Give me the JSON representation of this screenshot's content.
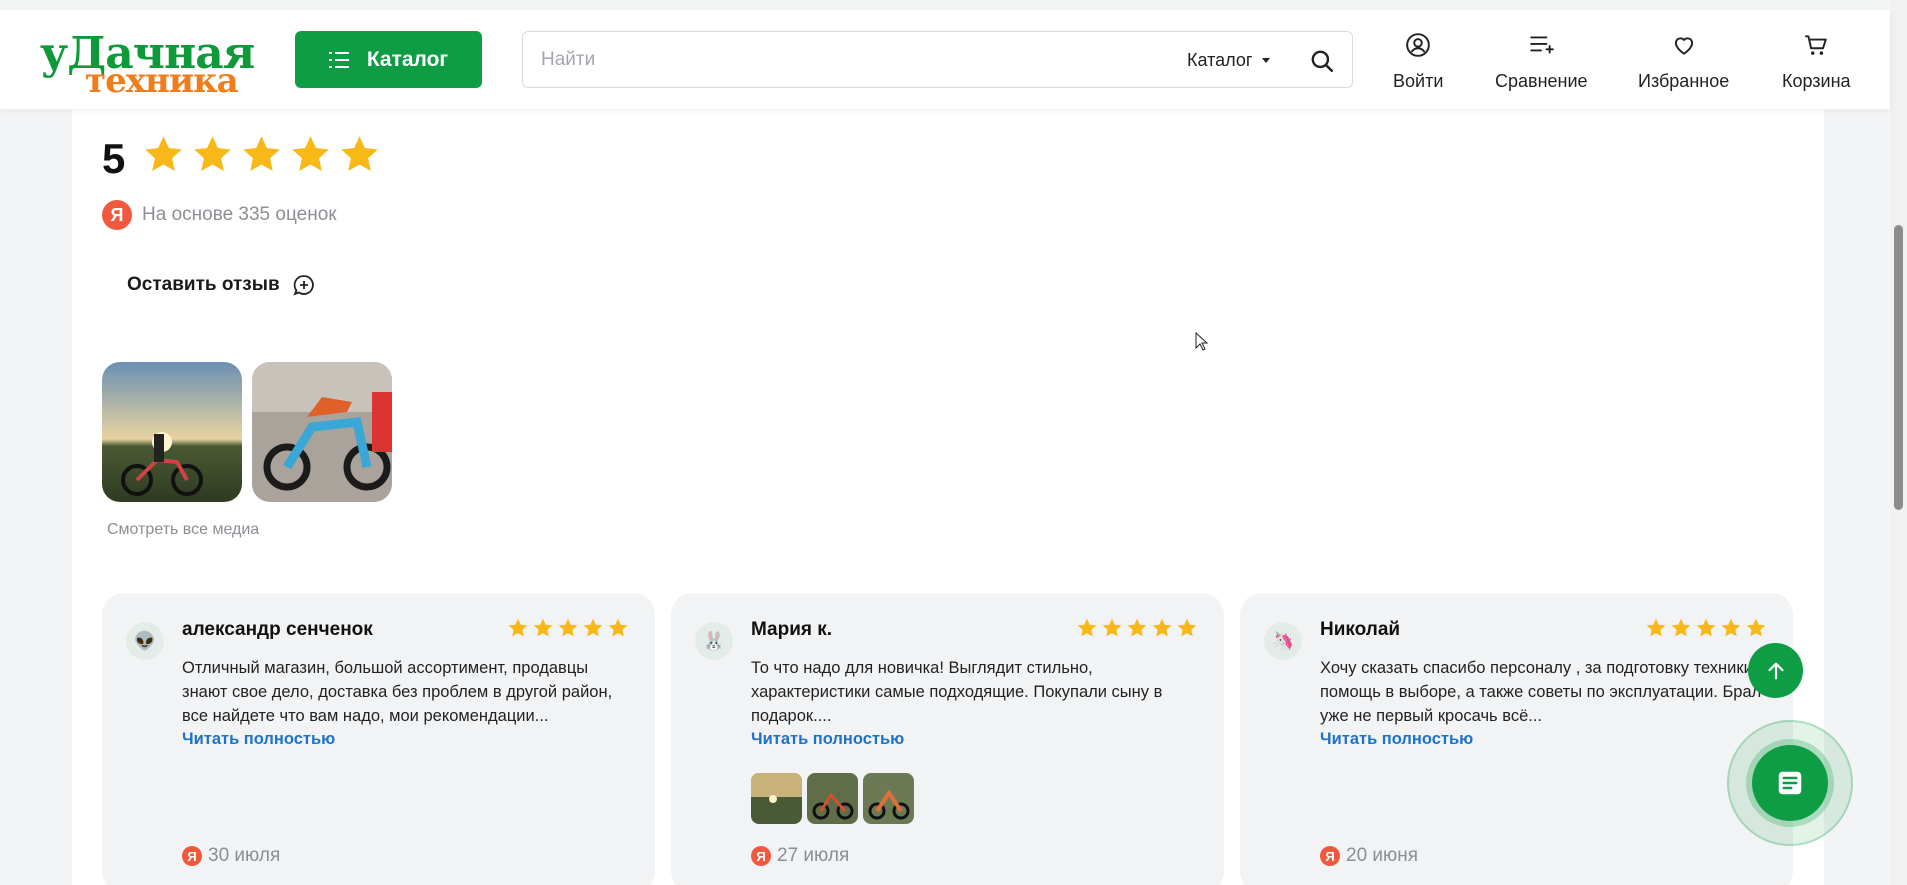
{
  "header": {
    "logo_line1": "уДачная",
    "logo_line2": "техника",
    "catalog_button": "Каталог",
    "search_placeholder": "Найти",
    "search_scope": "Каталог",
    "login": "Войти",
    "compare": "Сравнение",
    "favorites": "Избранное",
    "cart": "Корзина"
  },
  "rating": {
    "score": "5",
    "stars": 5,
    "basis_text": "На основе 335 оценок",
    "leave_review": "Оставить отзыв",
    "media_link": "Смотреть все медиа"
  },
  "reviews": [
    {
      "avatar": "👽",
      "name": "александр сенченок",
      "stars": 5,
      "text": "Отличный магазин, большой ассортимент, продавцы знают свое дело, доставка без проблем в другой район, все найдете что вам надо, мои рекомендации...",
      "more": "Читать полностью",
      "date": "30 июля"
    },
    {
      "avatar": "🐰",
      "name": "Мария к.",
      "stars": 5,
      "text": "То что надо для новичка! Выглядит стильно, характеристики самые подходящие. Покупали сыну в подарок....",
      "more": "Читать полностью",
      "date": "27 июля"
    },
    {
      "avatar": "🦄",
      "name": "Николай",
      "stars": 5,
      "text": "Хочу сказать спасибо персоналу , за подготовку техники, помощь в выборе, а также советы по эксплуатации. Брал уже не первый кросачь всё...",
      "more": "Читать полностью",
      "date": "20 июня"
    }
  ],
  "colors": {
    "brand_green": "#0e9d45",
    "logo_orange": "#f07d1a",
    "star": "#f8b918",
    "link_blue": "#1d73c8",
    "yandex_red": "#f0593e"
  }
}
